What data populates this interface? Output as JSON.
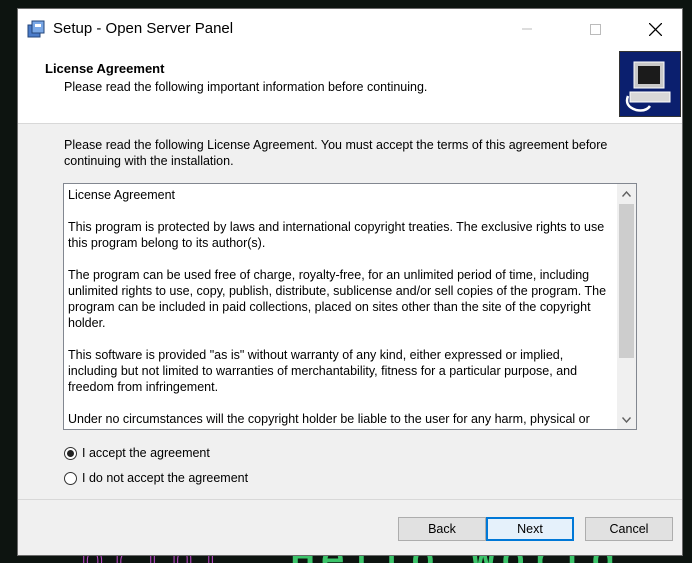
{
  "window": {
    "title": "Setup - Open Server Panel"
  },
  "header": {
    "title": "License Agreement",
    "subtitle": "Please read the following important information before continuing."
  },
  "intro": "Please read the following License Agreement. You must accept the terms of this agreement before continuing with the installation.",
  "license": {
    "paragraphs": [
      "License Agreement",
      "This program is protected by laws and international copyright treaties. The exclusive rights to use this program belong to its author(s).",
      "The program can be used free of charge, royalty-free, for an unlimited period of time, including unlimited rights to use, copy, publish, distribute, sublicense and/or sell copies of the program. The program can be included in paid collections, placed on sites other than the site of the copyright holder.",
      "This software is provided \"as is\" without warranty of any kind, either expressed or implied, including but not limited to warranties of merchantability, fitness for a particular purpose, and freedom from infringement.",
      "Under no circumstances will the copyright holder be liable to the user for any harm, physical or"
    ]
  },
  "options": {
    "accept": {
      "label": "I accept the agreement",
      "checked": true
    },
    "decline": {
      "label": "I do not accept the agreement",
      "checked": false
    }
  },
  "buttons": {
    "back": "Back",
    "next": "Next",
    "cancel": "Cancel"
  },
  "colors": {
    "accent": "#0078d7",
    "logo_bg": "#0b1f6e"
  }
}
